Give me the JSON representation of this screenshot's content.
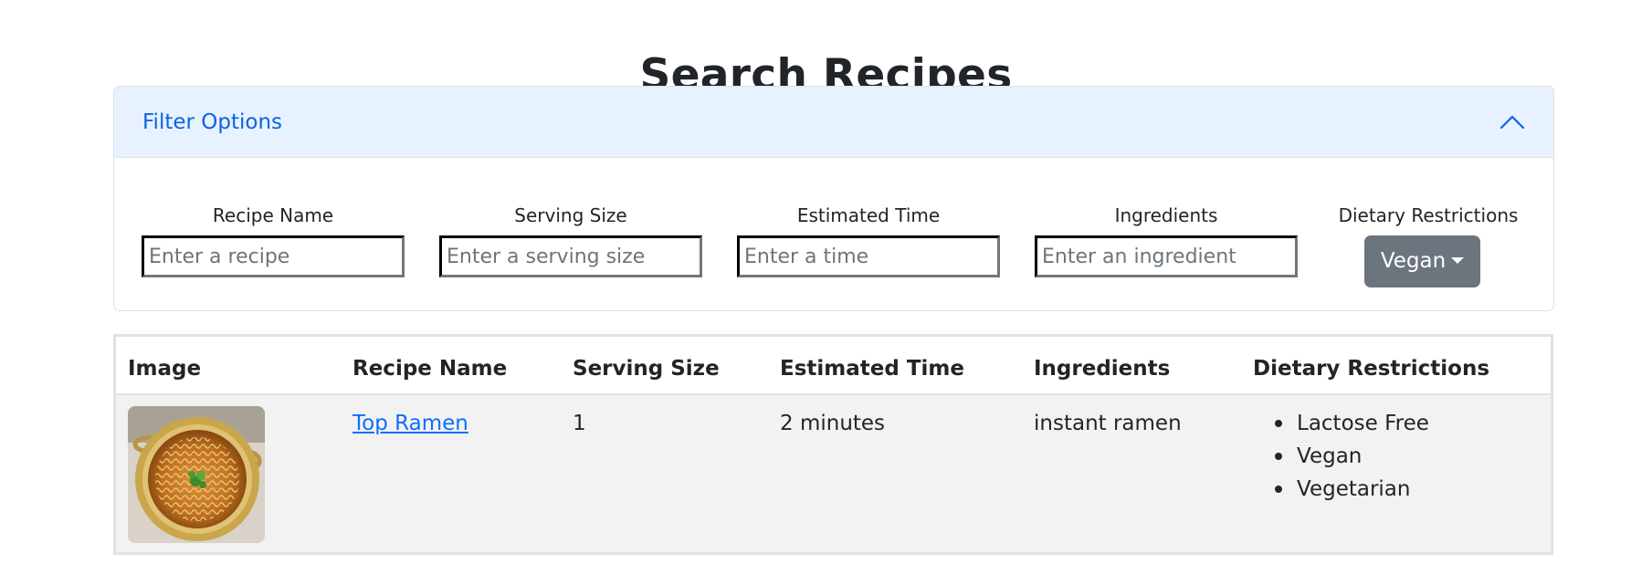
{
  "page": {
    "title": "Search Recipes"
  },
  "filters": {
    "title": "Filter Options",
    "expanded": true,
    "toggle_icon": "chevron-up-icon",
    "recipe_name": {
      "label": "Recipe Name",
      "placeholder": "Enter a recipe",
      "value": ""
    },
    "serving_size": {
      "label": "Serving Size",
      "placeholder": "Enter a serving size",
      "value": ""
    },
    "estimated_time": {
      "label": "Estimated Time",
      "placeholder": "Enter a time",
      "value": ""
    },
    "ingredients": {
      "label": "Ingredients",
      "placeholder": "Enter an ingredient",
      "value": ""
    },
    "dietary": {
      "label": "Dietary Restrictions",
      "selected": "Vegan"
    }
  },
  "table": {
    "headers": {
      "image": "Image",
      "recipe_name": "Recipe Name",
      "serving_size": "Serving Size",
      "estimated_time": "Estimated Time",
      "ingredients": "Ingredients",
      "dietary": "Dietary Restrictions"
    },
    "rows": [
      {
        "image_icon": "ramen-bowl-image",
        "recipe_name": "Top Ramen",
        "serving_size": "1",
        "estimated_time": "2 minutes",
        "ingredients": "instant ramen",
        "dietary": [
          "Lactose Free",
          "Vegan",
          "Vegetarian"
        ]
      }
    ]
  },
  "colors": {
    "accent": "#0c63e4",
    "header_bg": "#e7f1ff",
    "dropdown_bg": "#6c757d",
    "row_bg": "#f2f2f2"
  }
}
